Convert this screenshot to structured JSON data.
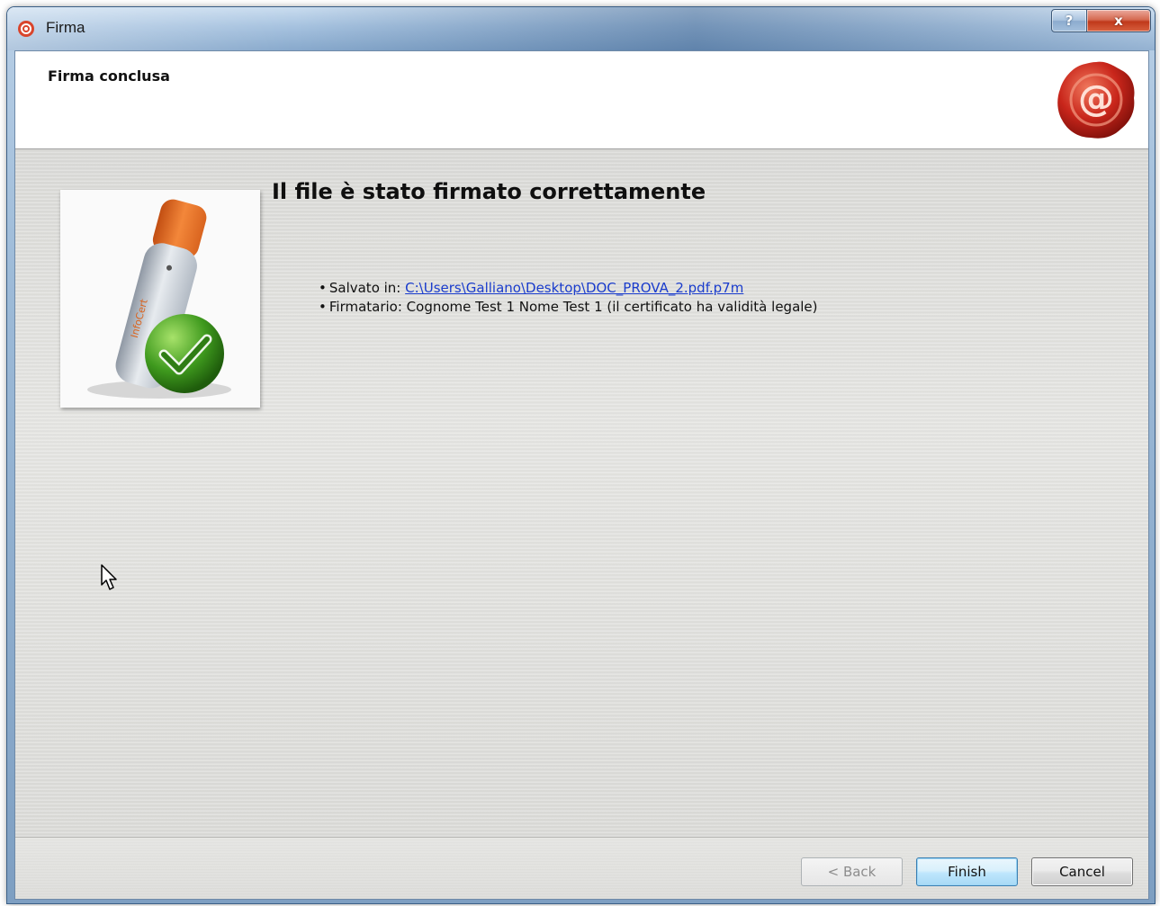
{
  "window": {
    "title": "Firma",
    "help_label": "?",
    "close_label": "x"
  },
  "header": {
    "title": "Firma conclusa",
    "logo_icon": "wax-seal-at-icon"
  },
  "main": {
    "heading": "Il file è stato firmato correttamente",
    "saved_label": "Salvato in: ",
    "saved_path": "C:\\Users\\Galliano\\Desktop\\DOC_PROVA_2.pdf.p7m",
    "signer_line": "Firmatario: Cognome Test 1 Nome Test 1 (il certificato ha validità legale)",
    "hero_icon": "usb-token-check-icon"
  },
  "buttons": {
    "back": "< Back",
    "finish": "Finish",
    "cancel": "Cancel"
  },
  "colors": {
    "link": "#1a3ccc",
    "seal": "#c9261b",
    "check": "#3f9a1e",
    "token_orange": "#e0681d"
  }
}
